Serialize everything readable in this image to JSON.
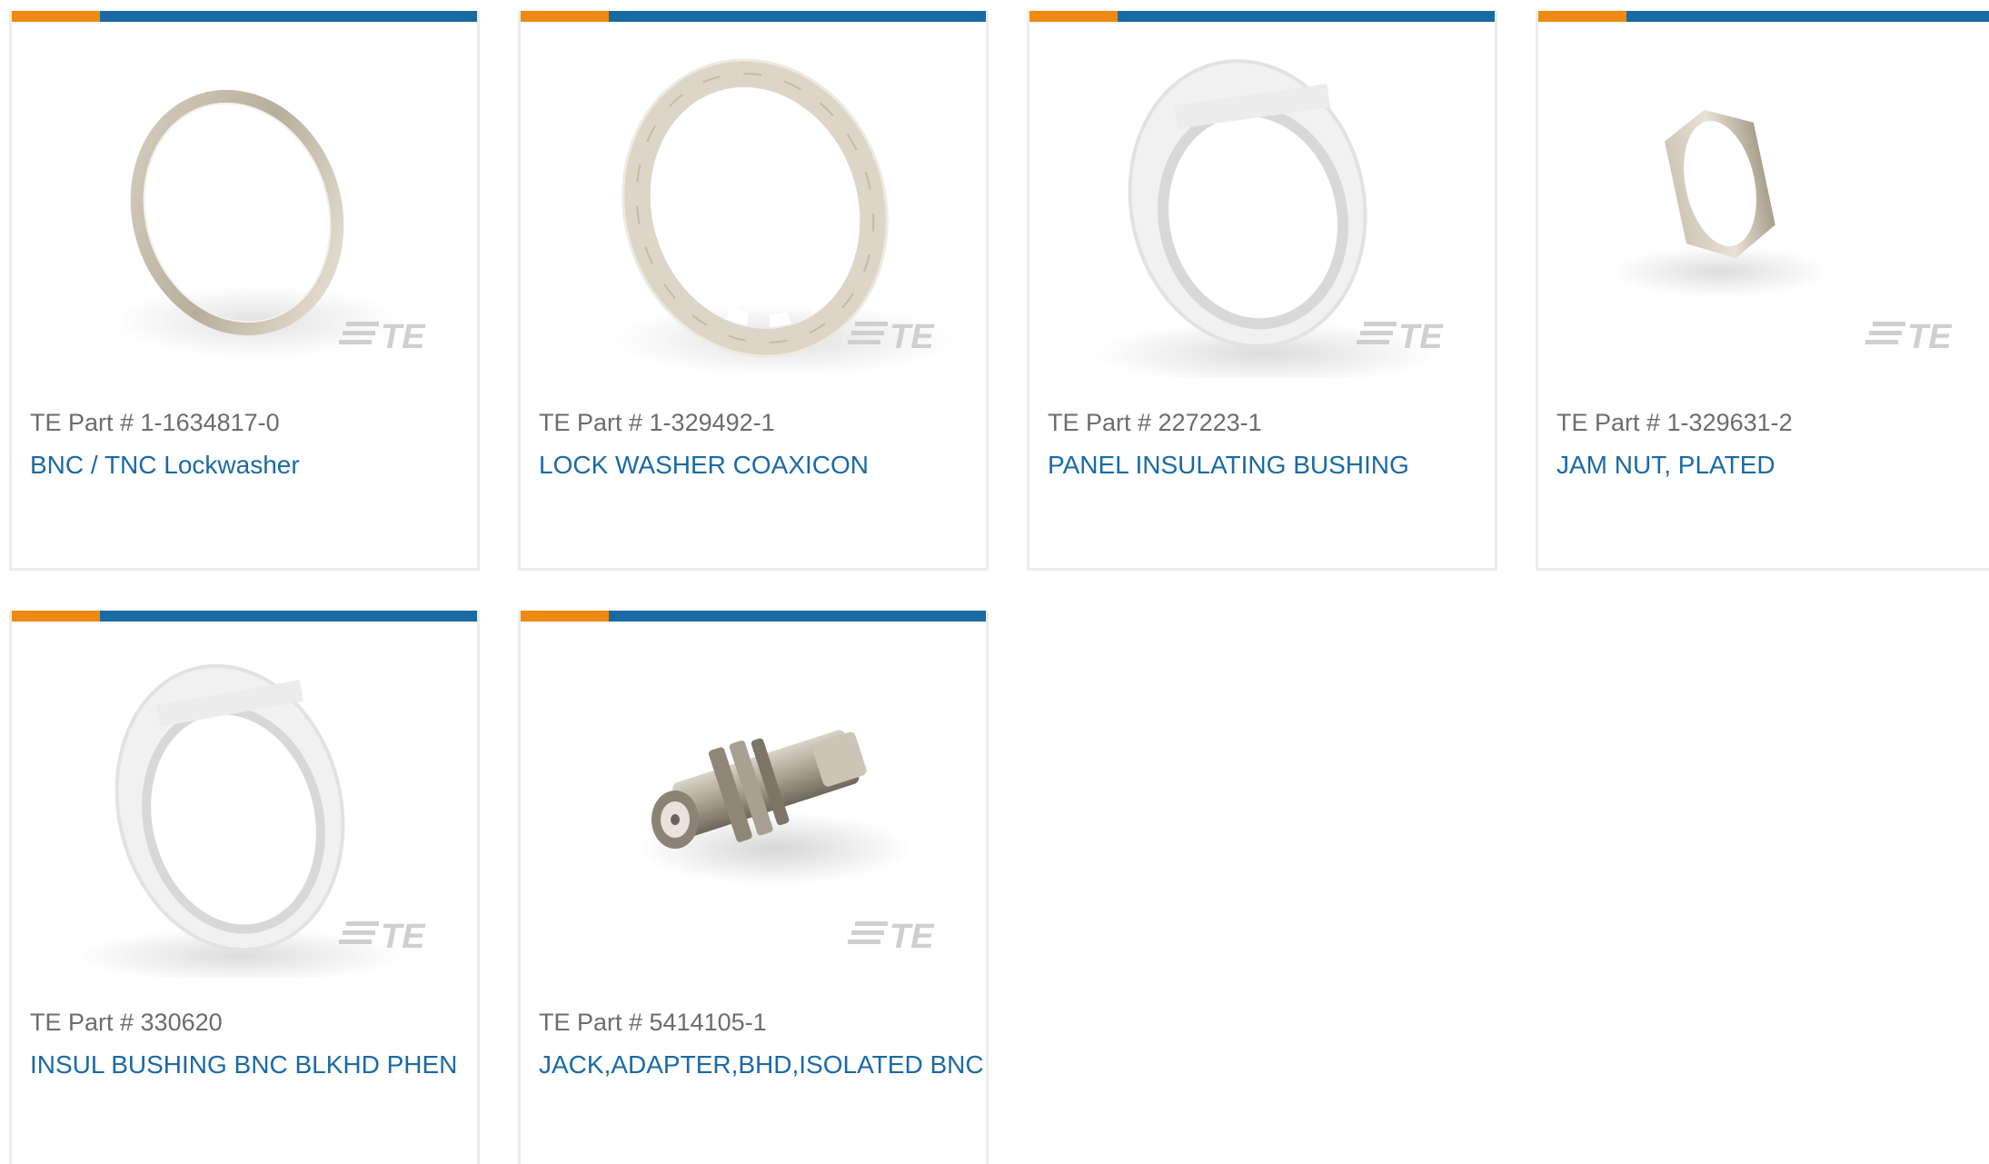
{
  "brand": {
    "orange": "#ee8a11",
    "blue": "#1a6aa3",
    "link": "#1b6aa5",
    "logo_text": "TE"
  },
  "products": [
    {
      "part_label": "TE Part # 1-1634817-0",
      "name": "BNC / TNC Lockwasher",
      "image": "lockwasher-ring-image"
    },
    {
      "part_label": "TE Part # 1-329492-1",
      "name": "LOCK WASHER COAXICON",
      "image": "toothed-lock-washer-image"
    },
    {
      "part_label": "TE Part # 227223-1",
      "name": "PANEL INSULATING BUSHING",
      "image": "insulating-bushing-image"
    },
    {
      "part_label": "TE Part # 1-329631-2",
      "name": "JAM NUT, PLATED",
      "image": "hex-jam-nut-image"
    },
    {
      "part_label": "TE Part # 330620",
      "name": "INSUL BUSHING BNC BLKHD PHEN",
      "image": "insulating-bushing-image"
    },
    {
      "part_label": "TE Part # 5414105-1",
      "name": "JACK,ADAPTER,BHD,ISOLATED BNC",
      "image": "bnc-adapter-image"
    }
  ]
}
